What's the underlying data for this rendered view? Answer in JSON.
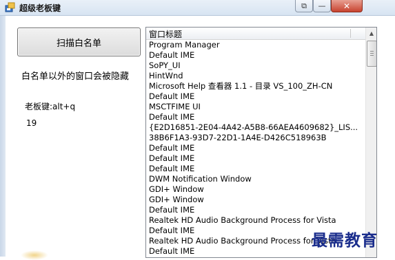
{
  "window": {
    "title": "超级老板键",
    "buttons": {
      "restore": "⧉",
      "minimize": "—",
      "close": "✕"
    }
  },
  "left_panel": {
    "scan_button": "扫描白名单",
    "info": "白名单以外的窗口会被隐藏",
    "hotkey": "老板键:alt+q",
    "count": "19"
  },
  "list": {
    "column_header": "窗口标题",
    "rows": [
      "Program Manager",
      "Default IME",
      "SoPY_UI",
      "HintWnd",
      "Microsoft Help 查看器 1.1 - 目录 VS_100_ZH-CN",
      "Default IME",
      "MSCTFIME UI",
      "Default IME",
      "{E2D16851-2E04-4A42-A5B8-66AEA4609682}_LIS...",
      "38B6F1A3-93D7-22D1-1A4E-D426C518963B",
      "Default IME",
      "Default IME",
      "Default IME",
      "DWM Notification Window",
      "GDI+ Window",
      "GDI+ Window",
      "Default IME",
      "Realtek HD Audio Background Process for Vista",
      "Default IME",
      "Realtek HD Audio Background Process for Vista",
      "Default IME"
    ]
  },
  "watermark": "最需教育",
  "colors": {
    "titlebar": "#dbe6f3",
    "close_button": "#c7432f",
    "watermark": "#1a2d8c"
  }
}
